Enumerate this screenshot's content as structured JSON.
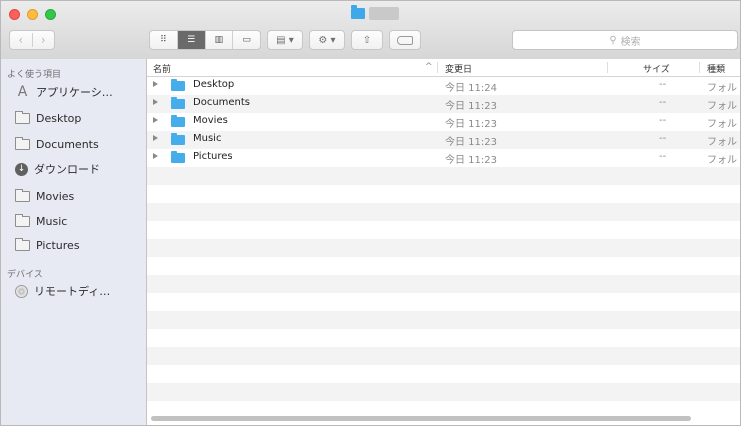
{
  "window": {
    "title_hidden": "",
    "colors": {
      "close": "#fc605c",
      "minimize": "#fdbc40",
      "maximize": "#34c84a",
      "folder": "#45aeea"
    }
  },
  "toolbar": {
    "back_label": "‹",
    "forward_label": "›",
    "view_icon": "⠿",
    "list_icon": "☰",
    "column_icon": "▥",
    "coverflow_icon": "▭",
    "arrange_label": "▤ ▾",
    "action_label": "⚙ ▾",
    "share_label": "⇧",
    "search_placeholder": "検索",
    "search_icon": "magnifier-icon"
  },
  "sidebar": {
    "favorites_header": "よく使う項目",
    "favorites": [
      {
        "label": "アプリケーシ…",
        "icon": "applications-icon"
      },
      {
        "label": "Desktop",
        "icon": "folder-icon"
      },
      {
        "label": "Documents",
        "icon": "folder-icon"
      },
      {
        "label": "ダウンロード",
        "icon": "download-icon"
      },
      {
        "label": "Movies",
        "icon": "folder-icon"
      },
      {
        "label": "Music",
        "icon": "folder-icon"
      },
      {
        "label": "Pictures",
        "icon": "folder-icon"
      }
    ],
    "devices_header": "デバイス",
    "devices": [
      {
        "label": "リモートディ…",
        "icon": "disc-icon"
      }
    ]
  },
  "list": {
    "columns": {
      "name": "名前",
      "sort_indicator": "^",
      "date": "変更日",
      "size": "サイズ",
      "kind": "種類"
    },
    "rows": [
      {
        "name": "Desktop",
        "date": "今日 11:24",
        "size": "--",
        "kind": "フォル"
      },
      {
        "name": "Documents",
        "date": "今日 11:23",
        "size": "--",
        "kind": "フォル"
      },
      {
        "name": "Movies",
        "date": "今日 11:23",
        "size": "--",
        "kind": "フォル"
      },
      {
        "name": "Music",
        "date": "今日 11:23",
        "size": "--",
        "kind": "フォル"
      },
      {
        "name": "Pictures",
        "date": "今日 11:23",
        "size": "--",
        "kind": "フォル"
      }
    ]
  }
}
